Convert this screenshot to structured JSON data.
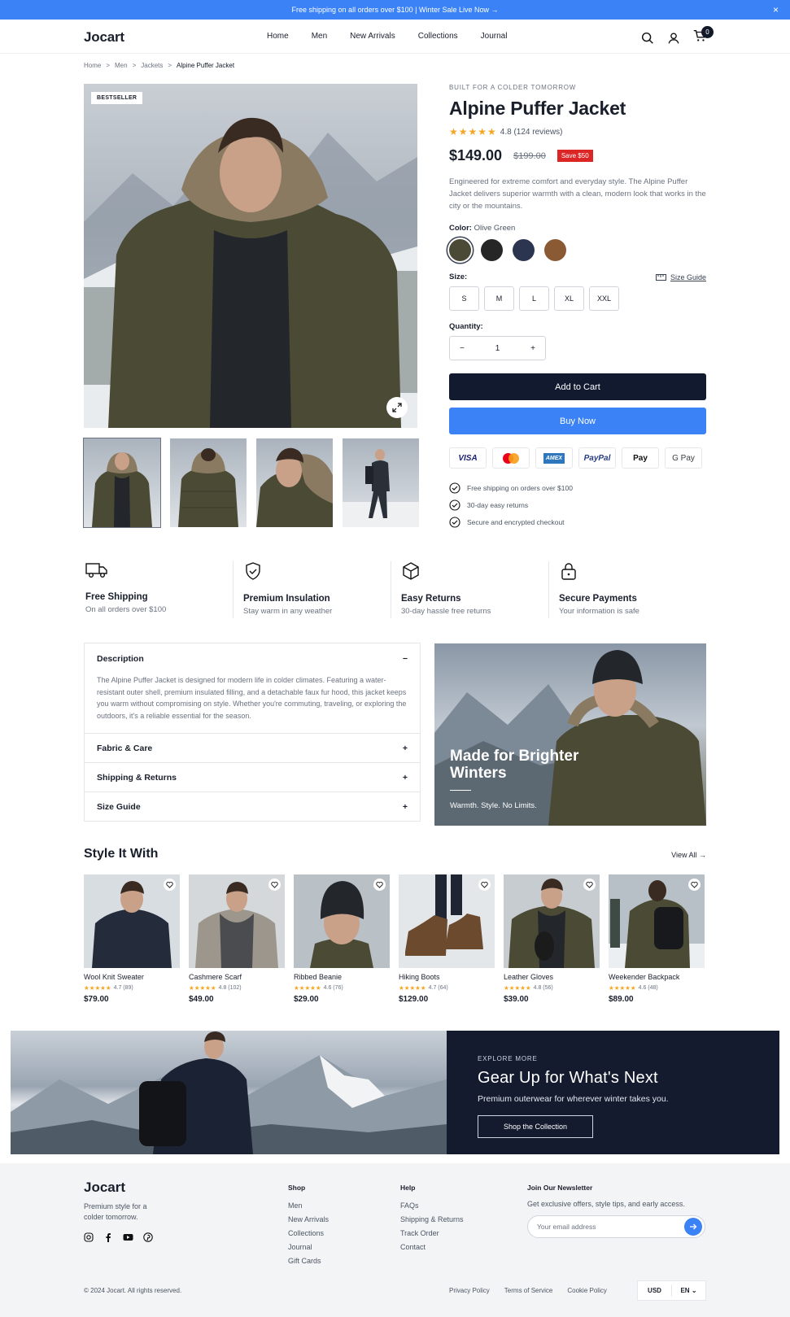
{
  "topbar": {
    "text": "Free shipping on all orders over $100   |   Winter Sale Live Now →",
    "close": "×"
  },
  "nav": {
    "logo": "Jocart",
    "links": [
      "Home",
      "Men",
      "New Arrivals",
      "Collections",
      "Journal"
    ],
    "cart_count": "0"
  },
  "breadcrumb": {
    "items": [
      "Home",
      "Men",
      "Jackets"
    ],
    "current": "Alpine Puffer Jacket",
    "sep": ">"
  },
  "gallery": {
    "badge": "BESTSELLER"
  },
  "product": {
    "eyebrow": "BUILT FOR A COLDER TOMORROW",
    "title": "Alpine Puffer Jacket",
    "stars": "★★★★★",
    "rating": "4.8 (124 reviews)",
    "price": "$149.00",
    "old_price": "$199.00",
    "save": "Save $50",
    "description": "Engineered for extreme comfort and everyday style. The Alpine Puffer Jacket delivers superior warmth with a clean, modern look that works in the city or the mountains.",
    "color_label": "Color:",
    "color_value": "Olive Green",
    "colors": [
      "#4a4a36",
      "#262626",
      "#2b3550",
      "#8a5a34"
    ],
    "size_label": "Size:",
    "size_guide": "Size Guide",
    "sizes": [
      "S",
      "M",
      "L",
      "XL",
      "XXL"
    ],
    "quantity_label": "Quantity:",
    "quantity": "1",
    "qty_minus": "−",
    "qty_plus": "+",
    "add_to_cart": "Add to Cart",
    "buy_now": "Buy Now",
    "payments": [
      "VISA",
      "",
      "AMEX",
      "PayPal",
      " Pay",
      "G Pay"
    ],
    "checks": [
      "Free shipping on orders over $100",
      "30-day easy returns",
      "Secure and encrypted checkout"
    ]
  },
  "features": [
    {
      "title": "Free Shipping",
      "sub": "On all orders over $100"
    },
    {
      "title": "Premium Insulation",
      "sub": "Stay warm in any weather"
    },
    {
      "title": "Easy Returns",
      "sub": "30-day hassle free returns"
    },
    {
      "title": "Secure Payments",
      "sub": "Your information is safe"
    }
  ],
  "accordion": {
    "description_title": "Description",
    "description_body": "The Alpine Puffer Jacket is designed for modern life in colder climates. Featuring a water-resistant outer shell, premium insulated filling, and a detachable faux fur hood, this jacket keeps you warm without compromising on style. Whether you're commuting, traveling, or exploring the outdoors, it's a reliable essential for the season.",
    "minus": "−",
    "plus": "+",
    "items": [
      "Fabric & Care",
      "Shipping & Returns",
      "Size Guide"
    ]
  },
  "promo": {
    "title": "Made for Brighter Winters",
    "sub": "Warmth. Style. No Limits."
  },
  "style_it": {
    "title": "Style It With",
    "view_all": "View All →"
  },
  "products": [
    {
      "name": "Wool Knit Sweater",
      "stars": "★★★★★",
      "rating": "4.7 (89)",
      "price": "$79.00"
    },
    {
      "name": "Cashmere Scarf",
      "stars": "★★★★★",
      "rating": "4.8 (102)",
      "price": "$49.00"
    },
    {
      "name": "Ribbed Beanie",
      "stars": "★★★★★",
      "rating": "4.6 (76)",
      "price": "$29.00"
    },
    {
      "name": "Hiking Boots",
      "stars": "★★★★★",
      "rating": "4.7 (64)",
      "price": "$129.00"
    },
    {
      "name": "Leather Gloves",
      "stars": "★★★★★",
      "rating": "4.8 (56)",
      "price": "$39.00"
    },
    {
      "name": "Weekender Backpack",
      "stars": "★★★★★",
      "rating": "4.6 (48)",
      "price": "$89.00"
    }
  ],
  "banner": {
    "eyebrow": "EXPLORE MORE",
    "title": "Gear Up for What's Next",
    "sub": "Premium outerwear for wherever winter takes you.",
    "button": "Shop the Collection"
  },
  "footer": {
    "logo": "Jocart",
    "tagline": "Premium style for a colder tomorrow.",
    "shop_title": "Shop",
    "shop": [
      "Men",
      "New Arrivals",
      "Collections",
      "Journal",
      "Gift Cards"
    ],
    "help_title": "Help",
    "help": [
      "FAQs",
      "Shipping & Returns",
      "Track Order",
      "Contact"
    ],
    "newsletter_title": "Join Our Newsletter",
    "newsletter_sub": "Get exclusive offers, style tips, and early access.",
    "email_placeholder": "Your email address",
    "copyright": "© 2024 Jocart. All rights reserved.",
    "links": [
      "Privacy Policy",
      "Terms of Service",
      "Cookie Policy"
    ],
    "currency": "USD",
    "language": "EN",
    "lang_chevron": "⌄"
  }
}
